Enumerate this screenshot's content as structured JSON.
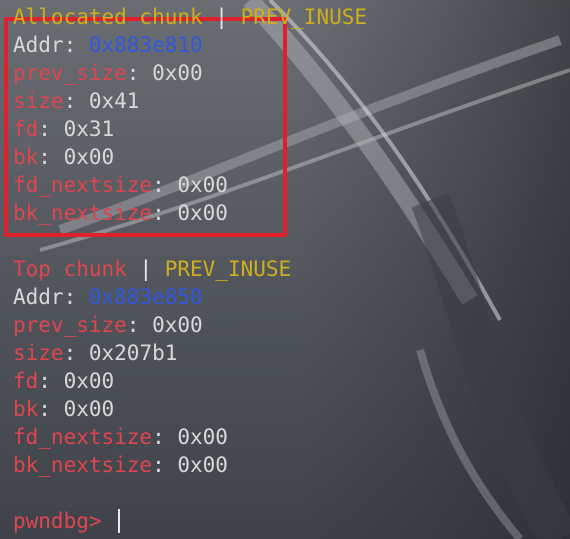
{
  "chunks": [
    {
      "type": "Allocated chunk",
      "sep": " | ",
      "flag": "PREV_INUSE",
      "addr_label": "Addr",
      "addr": "0x883e810",
      "fields": [
        {
          "name": "prev_size",
          "value": "0x00"
        },
        {
          "name": "size",
          "value": "0x41"
        },
        {
          "name": "fd",
          "value": "0x31"
        },
        {
          "name": "bk",
          "value": "0x00"
        },
        {
          "name": "fd_nextsize",
          "value": "0x00"
        },
        {
          "name": "bk_nextsize",
          "value": "0x00"
        }
      ]
    },
    {
      "type": "Top chunk",
      "sep": " | ",
      "flag": "PREV_INUSE",
      "addr_label": "Addr",
      "addr": "0x883e850",
      "fields": [
        {
          "name": "prev_size",
          "value": "0x00"
        },
        {
          "name": "size",
          "value": "0x207b1"
        },
        {
          "name": "fd",
          "value": "0x00"
        },
        {
          "name": "bk",
          "value": "0x00"
        },
        {
          "name": "fd_nextsize",
          "value": "0x00"
        },
        {
          "name": "bk_nextsize",
          "value": "0x00"
        }
      ]
    }
  ],
  "prompt": "pwndbg> ",
  "colors": {
    "red": "#e0444f",
    "yellow": "#cfae1c",
    "blue": "#2f57e0",
    "highlight": "#e0202a"
  }
}
